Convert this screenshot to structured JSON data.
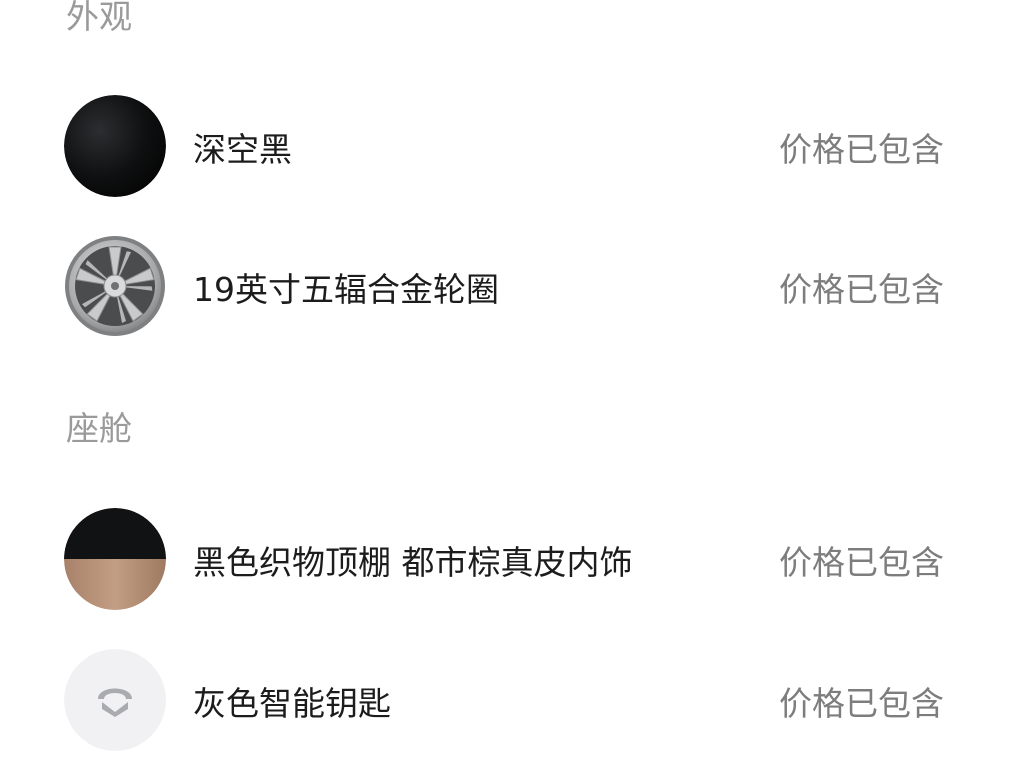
{
  "sections": [
    {
      "title": "外观",
      "items": [
        {
          "name": "深空黑",
          "status": "价格已包含",
          "swatch": "black-circle"
        },
        {
          "name": "19英寸五辐合金轮圈",
          "status": "价格已包含",
          "swatch": "wheel-icon"
        }
      ]
    },
    {
      "title": "座舱",
      "items": [
        {
          "name": "黑色织物顶棚 都市棕真皮内饰",
          "status": "价格已包含",
          "swatch": "black-brown-split"
        },
        {
          "name": "灰色智能钥匙",
          "status": "价格已包含",
          "swatch": "nio-key-icon"
        }
      ]
    }
  ],
  "colors": {
    "section_title": "#9a9a9a",
    "item_text": "#1c1c1c",
    "status_text": "#7d7d7d",
    "black_swatch": "#0e0f10",
    "brown_swatch": "#b58f74",
    "key_bg": "#f1f1f3",
    "key_logo": "#a9abae"
  }
}
